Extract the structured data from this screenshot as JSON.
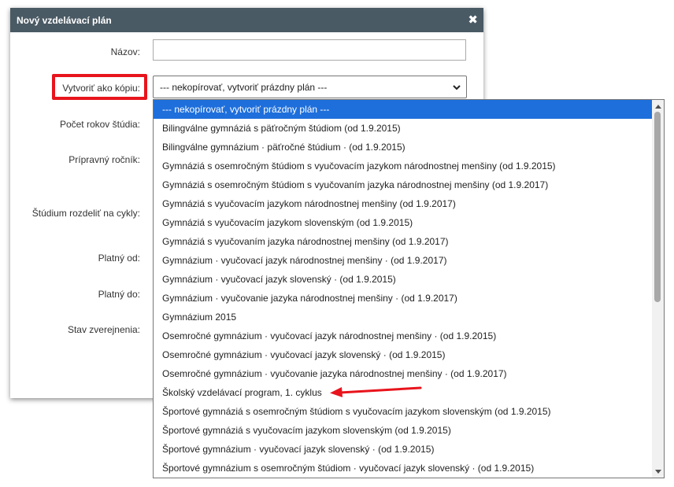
{
  "dialog": {
    "title": "Nový vzdelávací plán",
    "close_icon": "close-icon"
  },
  "form": {
    "name_label": "Názov:",
    "copy_label": "Vytvoriť ako kópiu:",
    "years_label": "Počet rokov štúdia:",
    "prep_label": "Prípravný ročník:",
    "cycles_label": "Štúdium rozdeliť na cykly:",
    "valid_from_label": "Platný od:",
    "valid_to_label": "Platný do:",
    "publish_label": "Stav zverejnenia:",
    "copy_select_value": "--- nekopírovať, vytvoriť prázdny plán ---"
  },
  "dropdown": {
    "options": [
      "--- nekopírovať, vytvoriť prázdny plán ---",
      "Bilingválne gymnáziá s päťročným štúdiom (od 1.9.2015)",
      "Bilingválne gymnázium · päťročné štúdium · (od 1.9.2015)",
      "Gymnáziá s osemročným štúdiom s vyučovacím jazykom národnostnej menšiny (od 1.9.2015)",
      "Gymnáziá s osemročným štúdiom s vyučovaním jazyka národnostnej menšiny (od 1.9.2017)",
      "Gymnáziá s vyučovacím jazykom národnostnej menšiny (od 1.9.2017)",
      "Gymnáziá s vyučovacím jazykom slovenským (od 1.9.2015)",
      "Gymnáziá s vyučovaním jazyka národnostnej menšiny (od 1.9.2017)",
      "Gymnázium · vyučovací jazyk národnostnej menšiny · (od 1.9.2017)",
      "Gymnázium · vyučovací jazyk slovenský · (od 1.9.2015)",
      "Gymnázium · vyučovanie jazyka národnostnej menšiny · (od 1.9.2017)",
      "Gymnázium 2015",
      "Osemročné gymnázium · vyučovací jazyk národnostnej menšiny · (od 1.9.2015)",
      "Osemročné gymnázium · vyučovací jazyk slovenský · (od 1.9.2015)",
      "Osemročné gymnázium · vyučovanie jazyka národnostnej menšiny · (od 1.9.2017)",
      "Školský vzdelávací program, 1. cyklus",
      "Športové gymnáziá s osemročným štúdiom s vyučovacím jazykom slovenským (od 1.9.2015)",
      "Športové gymnáziá s vyučovacím jazykom slovenským (od 1.9.2015)",
      "Športové gymnázium · vyučovací jazyk slovenský · (od 1.9.2015)",
      "Športové gymnázium s osemročným štúdiom · vyučovací jazyk slovenský · (od 1.9.2015)"
    ],
    "selected_index": 0
  },
  "colors": {
    "titlebar": "#4a5a64",
    "selected_option": "#1e6fdc",
    "highlight": "#e8141c"
  }
}
